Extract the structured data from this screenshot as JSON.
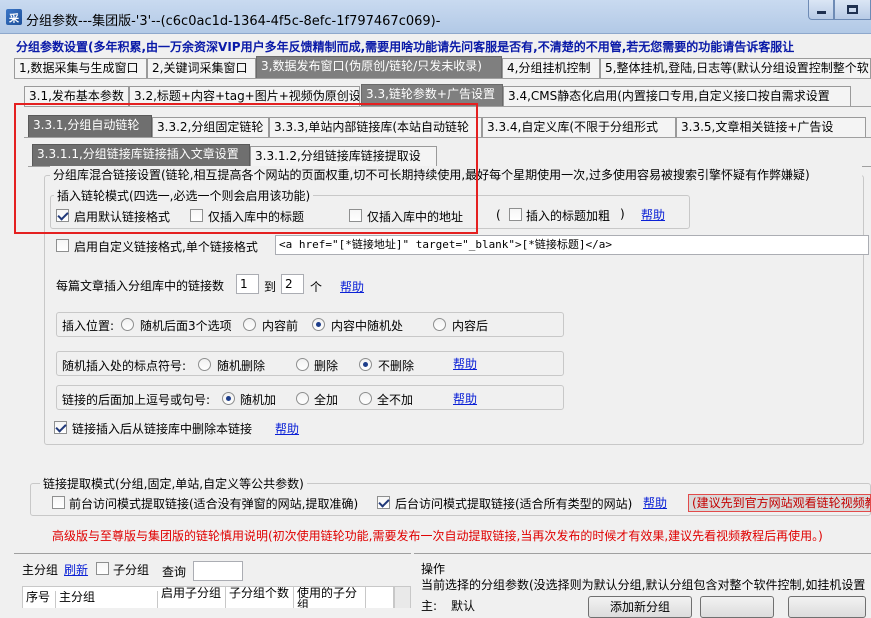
{
  "window": {
    "title": "分组参数---集团版-'3'--(c6c0ac1d-1364-4f5c-8efc-1f797467c069)-",
    "icon_label": "采"
  },
  "banner": "分组参数设置(多年积累,由一万余资深VIP用户多年反馈精制而成,需要用啥功能请先问客服是否有,不清楚的不用管,若无您需要的功能请告诉客服让",
  "main_tabs": [
    "1,数据采集与生成窗口",
    "2,关键词采集窗口",
    "3,数据发布窗口(伪原创/链轮/只发未收录)",
    "4,分组挂机控制",
    "5,整体挂机,登陆,日志等(默认分组设置控制整个软"
  ],
  "sub_tabs": [
    "3.1,发布基本参数",
    "3.2,标题+内容+tag+图片+视频伪原创设",
    "3.3,链轮参数+广告设置",
    "3.4,CMS静态化启用(内置接口专用,自定义接口按自需求设置"
  ],
  "link_tabs": [
    "3.3.1,分组自动链轮",
    "3.3.2,分组固定链轮",
    "3.3.3,单站内部链接库(本站自动链轮",
    "3.3.4,自定义库(不限于分组形式",
    "3.3.5,文章相关链接+广告设"
  ],
  "insert_tabs": [
    "3.3.1.1,分组链接库链接插入文章设置",
    "3.3.1.2,分组链接库链接提取设"
  ],
  "mixed_group": {
    "legend": "分组库混合链接设置(链轮,相互提高各个网站的页面权重,切不可长期持续使用,最好每个星期使用一次,过多使用容易被搜索引擎怀疑有作弊嫌疑)",
    "mode_legend": "插入链轮模式(四选一,必选一个则会启用该功能)",
    "mode_options": [
      {
        "label": "启用默认链接格式",
        "checked": true
      },
      {
        "label": "仅插入库中的标题",
        "checked": false
      },
      {
        "label": "仅插入库中的地址",
        "checked": false
      },
      {
        "label": "插入的标题加粗",
        "checked": false
      }
    ],
    "paren_open": "(",
    "paren_close": ")",
    "help": "帮助",
    "custom_format_label": "启用自定义链接格式,单个链接格式",
    "custom_format_checked": false,
    "custom_format_value": "<a href=\"[*链接地址]\" target=\"_blank\">[*链接标题]</a>",
    "count_label": "每篇文章插入分组库中的链接数",
    "count_from": "1",
    "count_to_label": "到",
    "count_to": "2",
    "count_unit": "个",
    "position_label": "插入位置:",
    "position_options": [
      {
        "label": "随机后面3个选项",
        "checked": false
      },
      {
        "label": "内容前",
        "checked": false
      },
      {
        "label": "内容中随机处",
        "checked": true
      },
      {
        "label": "内容后",
        "checked": false
      }
    ],
    "punct_label": "随机插入处的标点符号:",
    "punct_options": [
      {
        "label": "随机删除",
        "checked": false
      },
      {
        "label": "删除",
        "checked": false
      },
      {
        "label": "不删除",
        "checked": true
      }
    ],
    "comma_label": "链接的后面加上逗号或句号:",
    "comma_options": [
      {
        "label": "随机加",
        "checked": true
      },
      {
        "label": "全加",
        "checked": false
      },
      {
        "label": "全不加",
        "checked": false
      }
    ],
    "delete_after_label": "链接插入后从链接库中删除本链接",
    "delete_after_checked": true
  },
  "extract_group": {
    "legend": "链接提取模式(分组,固定,单站,自定义等公共参数)",
    "front_label": "前台访问模式提取链接(适合没有弹窗的网站,提取准确)",
    "front_checked": false,
    "back_label": "后台访问模式提取链接(适合所有类型的网站)",
    "back_checked": true,
    "help": "帮助",
    "warn": "(建议先到官方网站观看链轮视频教"
  },
  "notice": "高级版与至尊版与集团版的链轮慎用说明(初次使用链轮功能,需要发布一次自动提取链接,当再次发布的时候才有效果,建议先看视频教程后再使用。)",
  "bottom_left": {
    "title": "主分组",
    "refresh": "刷新",
    "sub_group_label": "子分组",
    "sub_group_checked": false,
    "query_label": "查询",
    "query_value": "",
    "columns": [
      "序号",
      "主分组",
      "启用子分组",
      "子分组个数",
      "使用的子分组"
    ]
  },
  "bottom_right": {
    "title": "操作",
    "desc": "当前选择的分组参数(没选择则为默认分组,默认分组包含对整个软件控制,如挂机设置",
    "main_label": "主:",
    "main_value": "默认",
    "add_button": "添加新分组"
  },
  "colors": {
    "highlight": "#e42020",
    "link": "#0b21d6",
    "banner": "#0a1aa8",
    "notice": "#e00000"
  }
}
